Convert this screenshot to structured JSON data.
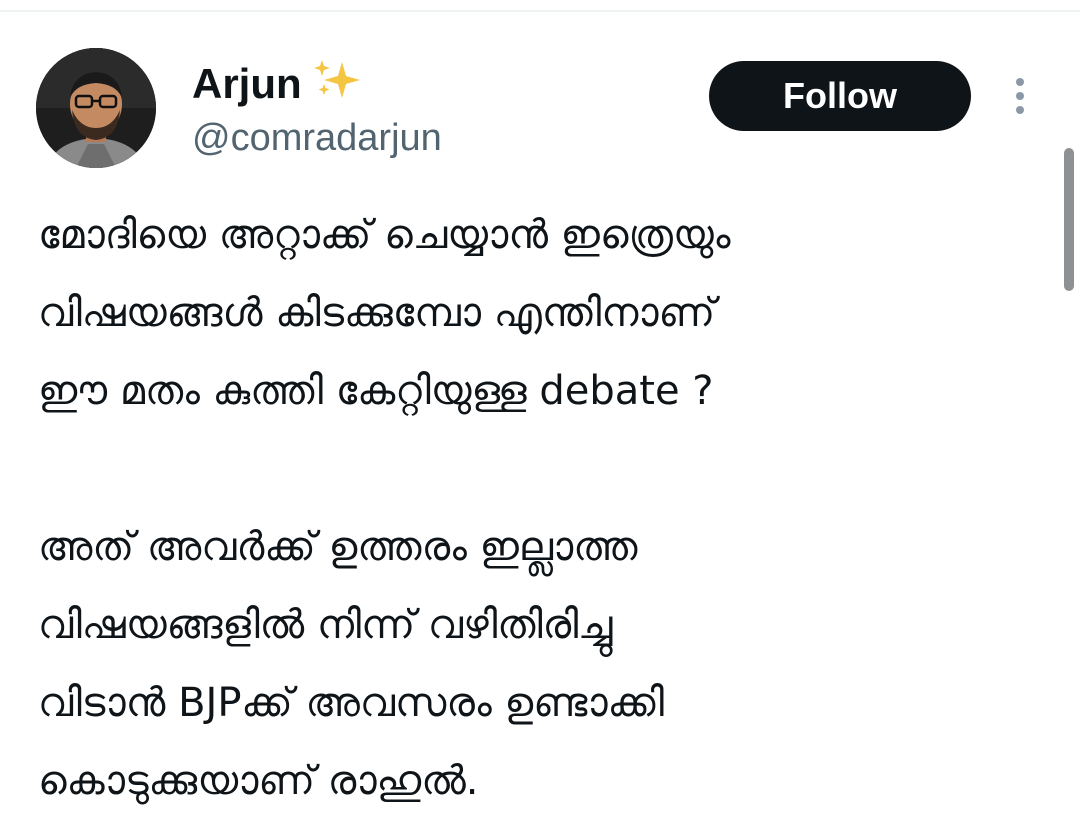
{
  "author": {
    "display_name": "Arjun",
    "verified_badge_icon": "sparkles-icon",
    "handle": "@comradarjun",
    "avatar_icon": "profile-photo"
  },
  "actions": {
    "follow_label": "Follow",
    "more_icon": "vertical-ellipsis-icon"
  },
  "tweet": {
    "paragraphs": [
      {
        "lines": [
          "മോദിയെ അറ്റാക്ക് ചെയ്യാൻ ഇത്രെയും",
          "വിഷയങ്ങൾ കിടക്കുമ്പോ എന്തിനാണ്",
          "ഈ മതം കുത്തി കേറ്റിയുള്ള debate ?"
        ]
      },
      {
        "lines": [
          "അത് അവർക്ക് ഉത്തരം ഇല്ലാത്ത",
          "വിഷയങ്ങളിൽ  നിന്ന് വഴിതിരിച്ചു",
          "വിടാൻ BJPക്ക് അവസരം ഉണ്ടാക്കി",
          "കൊടുക്കുയാണ് രാഹുൽ."
        ]
      }
    ]
  },
  "colors": {
    "text_primary": "#0f1419",
    "text_secondary": "#536471",
    "button_bg": "#0f1419",
    "button_text": "#ffffff",
    "sparkle": "#f4c542"
  }
}
